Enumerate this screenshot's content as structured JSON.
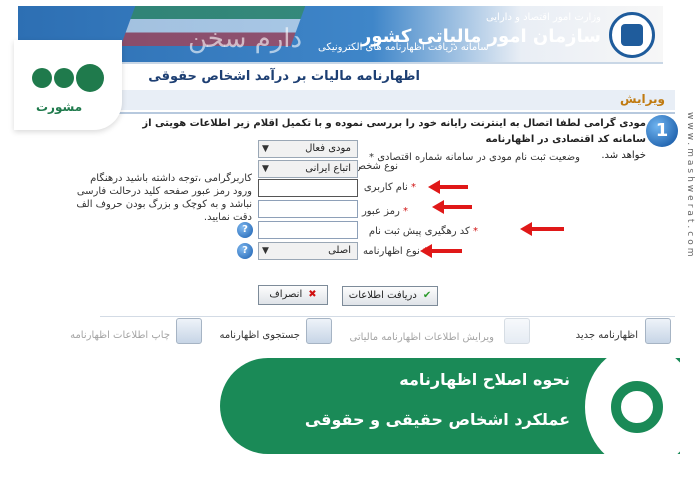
{
  "header": {
    "org_sub": "وزارت امور اقتصاد و دارایی",
    "org_main": "سازمان امور مالیاتی کشور",
    "service": "سامانه دریافت اظهارنامه های الکترونیکی",
    "calligraphy": "دارم سخن"
  },
  "page_title": "اظهارنامه مالیات بر درآمد اشخاص حقوقی",
  "tab": "ویرایش",
  "step_number": "1",
  "intro": {
    "line1": "مودی گرامی لطفا اتصال به اینترنت رایانه خود را بررسی نموده و با تکمیل اقلام زیر اطلاعات هویتی از سامانه کد اقتصادی در اظهارنامه",
    "line2": "خواهد شد.",
    "line3": "وضعیت ثبت نام مودی در سامانه شماره اقتصادی *"
  },
  "form": {
    "status_label": "وضعیت ثبت نام مودی در سامانه شماره اقتصادی *",
    "status_value": "مودی فعال",
    "person_type_label": "نوع شخص",
    "person_type_value": "اتباع ایرانی",
    "username_label": "نام کاربری",
    "password_label": "رمز عبور",
    "tracking_label": "کد رهگیری پیش ثبت نام",
    "return_type_label": "نوع اظهارنامه",
    "return_type_value": "اصلی",
    "star": "*",
    "help_glyph": "?"
  },
  "note": "کاربرگرامی ،توجه داشته باشید درهنگام ورود رمز عبور صفحه کلید درحالت فارسی نباشد و به کوچک و بزرگ بودن حروف الف دقت نمایید.",
  "buttons": {
    "cancel": "انصراف",
    "submit": "دریافت اطلاعات"
  },
  "toolbar": {
    "new_return": "اظهارنامه جدید",
    "edit_info": "ویرایش اطلاعات اظهارنامه مالیاتی",
    "search_return": "جستجوی اظهارنامه",
    "print_info": "چاپ اطلاعات اظهارنامه"
  },
  "side_watermark": "www.mashwerat.com",
  "brand": {
    "name": "مشورت"
  },
  "caption": {
    "line1": "نحوه اصلاح اظهارنامه",
    "line2": "عملکرد اشخاص حقیقی و حقوقی"
  },
  "colors": {
    "header_blue": "#2d6fb3",
    "accent_green": "#1a8a57",
    "arrow_red": "#e01818"
  }
}
